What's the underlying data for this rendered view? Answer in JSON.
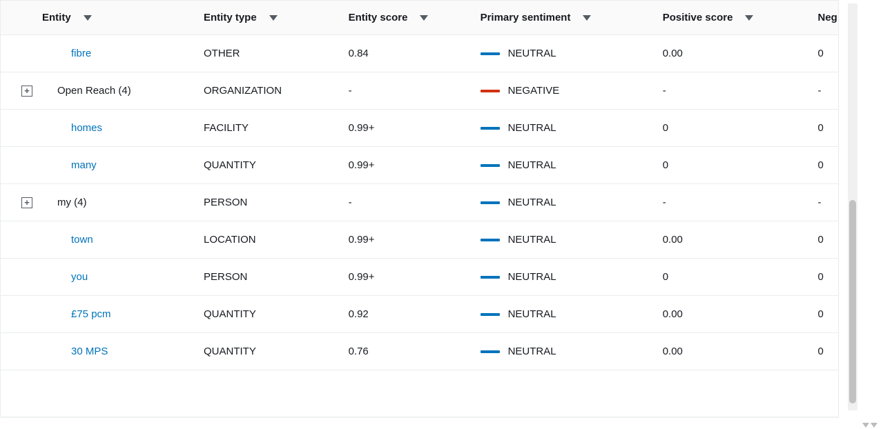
{
  "table": {
    "columns": {
      "entity": "Entity",
      "entity_type": "Entity type",
      "entity_score": "Entity score",
      "primary_sentiment": "Primary sentiment",
      "positive_score": "Positive score",
      "negative_score": "Neg"
    },
    "rows": [
      {
        "expandable": false,
        "indent": true,
        "link": true,
        "entity": "fibre",
        "type": "OTHER",
        "score": "0.84",
        "sentiment": "NEUTRAL",
        "sentiment_color": "neutral",
        "positive": "0.00",
        "negative_partial": "0"
      },
      {
        "expandable": true,
        "indent": false,
        "link": false,
        "entity": "Open Reach (4)",
        "type": "ORGANIZATION",
        "score": "-",
        "sentiment": "NEGATIVE",
        "sentiment_color": "negative",
        "positive": "-",
        "negative_partial": "-"
      },
      {
        "expandable": false,
        "indent": true,
        "link": true,
        "entity": "homes",
        "type": "FACILITY",
        "score": "0.99+",
        "sentiment": "NEUTRAL",
        "sentiment_color": "neutral",
        "positive": "0",
        "negative_partial": "0"
      },
      {
        "expandable": false,
        "indent": true,
        "link": true,
        "entity": "many",
        "type": "QUANTITY",
        "score": "0.99+",
        "sentiment": "NEUTRAL",
        "sentiment_color": "neutral",
        "positive": "0",
        "negative_partial": "0"
      },
      {
        "expandable": true,
        "indent": false,
        "link": false,
        "entity": "my (4)",
        "type": "PERSON",
        "score": "-",
        "sentiment": "NEUTRAL",
        "sentiment_color": "neutral",
        "positive": "-",
        "negative_partial": "-"
      },
      {
        "expandable": false,
        "indent": true,
        "link": true,
        "entity": "town",
        "type": "LOCATION",
        "score": "0.99+",
        "sentiment": "NEUTRAL",
        "sentiment_color": "neutral",
        "positive": "0.00",
        "negative_partial": "0"
      },
      {
        "expandable": false,
        "indent": true,
        "link": true,
        "entity": "you",
        "type": "PERSON",
        "score": "0.99+",
        "sentiment": "NEUTRAL",
        "sentiment_color": "neutral",
        "positive": "0",
        "negative_partial": "0"
      },
      {
        "expandable": false,
        "indent": true,
        "link": true,
        "entity": "£75 pcm",
        "type": "QUANTITY",
        "score": "0.92",
        "sentiment": "NEUTRAL",
        "sentiment_color": "neutral",
        "positive": "0.00",
        "negative_partial": "0"
      },
      {
        "expandable": false,
        "indent": true,
        "link": true,
        "entity": "30 MPS",
        "type": "QUANTITY",
        "score": "0.76",
        "sentiment": "NEUTRAL",
        "sentiment_color": "neutral",
        "positive": "0.00",
        "negative_partial": "0"
      }
    ]
  }
}
